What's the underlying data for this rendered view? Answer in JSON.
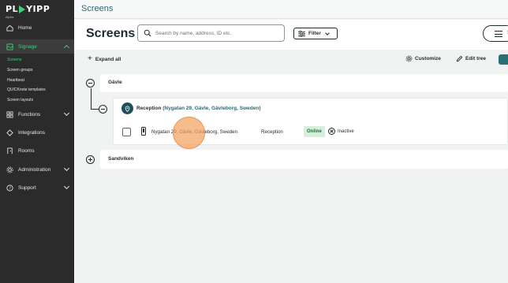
{
  "brand": {
    "name_left": "PL",
    "name_right": "YIPP",
    "sub": "Alpha",
    "accent": "#3ed177"
  },
  "sidebar": {
    "items": [
      {
        "label": "Home",
        "icon": "home-icon"
      },
      {
        "label": "Signage",
        "icon": "signage-icon",
        "active": true,
        "expanded": true
      },
      {
        "label": "Functions",
        "icon": "functions-icon"
      },
      {
        "label": "Integrations",
        "icon": "integrations-icon"
      },
      {
        "label": "Rooms",
        "icon": "rooms-icon"
      },
      {
        "label": "Administration",
        "icon": "gear-icon"
      },
      {
        "label": "Support",
        "icon": "help-icon"
      }
    ],
    "signage_sub": [
      {
        "label": "Screens",
        "active": true
      },
      {
        "label": "Screen groups"
      },
      {
        "label": "Heartbeat"
      },
      {
        "label": "QUICKnote templates"
      },
      {
        "label": "Screen layouts"
      }
    ]
  },
  "topbar": {
    "title": "Screens"
  },
  "header": {
    "title": "Screens",
    "search_placeholder": "Search by name, address, ID etc.",
    "filter_label": "Filter",
    "settings_partial": "S"
  },
  "toolbar": {
    "expand_all": "Expand all",
    "customize": "Customize",
    "edit_tree": "Edit tree"
  },
  "tree": {
    "group1": {
      "label": "Gävle"
    },
    "location": {
      "name": "Reception",
      "address": "(Nygatan 29, Gävle, Gävleborg, Sweden)"
    },
    "screen": {
      "address": "Nygatan 29, Gävle, Gävleborg, Sweden",
      "location": "Reception",
      "status": "Online",
      "state": "Inactive"
    },
    "group2": {
      "label": "Sandviken"
    }
  },
  "colors": {
    "sidebar_bg": "#2b2b2b",
    "primary": "#2d6a73",
    "online_bg": "#d4f0dc",
    "cursor": "#f4a25e"
  }
}
